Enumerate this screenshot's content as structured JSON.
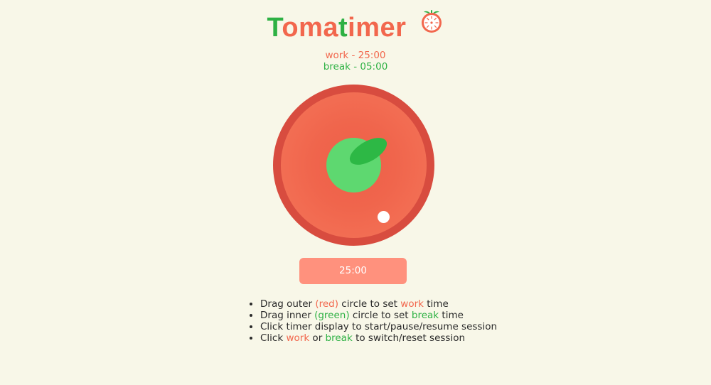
{
  "header": {
    "title_parts": [
      {
        "text": "T",
        "color": "#2eb144"
      },
      {
        "text": "oma",
        "color": "#f2674d"
      },
      {
        "text": "t",
        "color": "#2eb144"
      },
      {
        "text": "imer",
        "color": "#f2674d"
      }
    ],
    "logo_icon": "tomato-icon"
  },
  "durations": {
    "work": "work - 25:00",
    "break": "break - 05:00"
  },
  "timer": {
    "display": "25:00"
  },
  "instructions": [
    [
      {
        "text": "Drag outer "
      },
      {
        "text": "(red)",
        "color": "#f2674d"
      },
      {
        "text": " circle to set "
      },
      {
        "text": "work",
        "color": "#f2674d"
      },
      {
        "text": " time"
      }
    ],
    [
      {
        "text": "Drag inner "
      },
      {
        "text": "(green)",
        "color": "#2eb144"
      },
      {
        "text": " circle to set "
      },
      {
        "text": "break",
        "color": "#2eb144"
      },
      {
        "text": " time"
      }
    ],
    [
      {
        "text": "Click timer display to start/pause/resume session"
      }
    ],
    [
      {
        "text": "Click "
      },
      {
        "text": "work",
        "color": "#f2674d"
      },
      {
        "text": " or "
      },
      {
        "text": "break",
        "color": "#2eb144"
      },
      {
        "text": " to switch/reset session"
      }
    ]
  ],
  "colors": {
    "background": "#f8f7e8",
    "work_red": "#f2674d",
    "break_green": "#2eb144",
    "timer_button": "#ff917d"
  }
}
